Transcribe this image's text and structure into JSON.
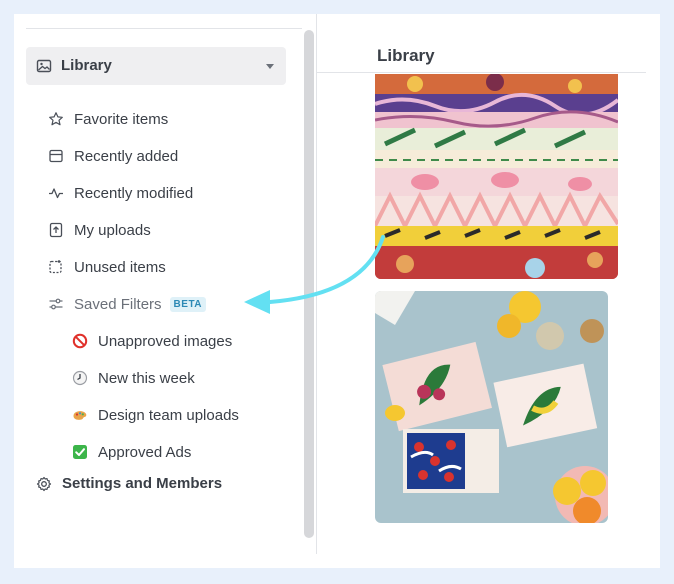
{
  "sidebar": {
    "library_label": "Library",
    "items": [
      {
        "label": "Favorite items",
        "icon": "star-icon"
      },
      {
        "label": "Recently added",
        "icon": "inbox-icon"
      },
      {
        "label": "Recently modified",
        "icon": "activity-icon"
      },
      {
        "label": "My uploads",
        "icon": "upload-icon"
      },
      {
        "label": "Unused items",
        "icon": "unused-icon"
      }
    ],
    "saved_filters": {
      "label": "Saved Filters",
      "badge": "BETA",
      "icon": "sliders-icon"
    },
    "filters": [
      {
        "label": "Unapproved images",
        "icon": "prohibited-icon"
      },
      {
        "label": "New this week",
        "icon": "clock-icon"
      },
      {
        "label": "Design team uploads",
        "icon": "palette-icon"
      },
      {
        "label": "Approved Ads",
        "icon": "check-icon"
      }
    ],
    "settings_label": "Settings and Members"
  },
  "main": {
    "title": "Library"
  },
  "colors": {
    "background": "#e8f0fb",
    "accent_arrow": "#63e0f2",
    "beta_text": "#2c89b5",
    "beta_bg": "#dff1f8"
  }
}
